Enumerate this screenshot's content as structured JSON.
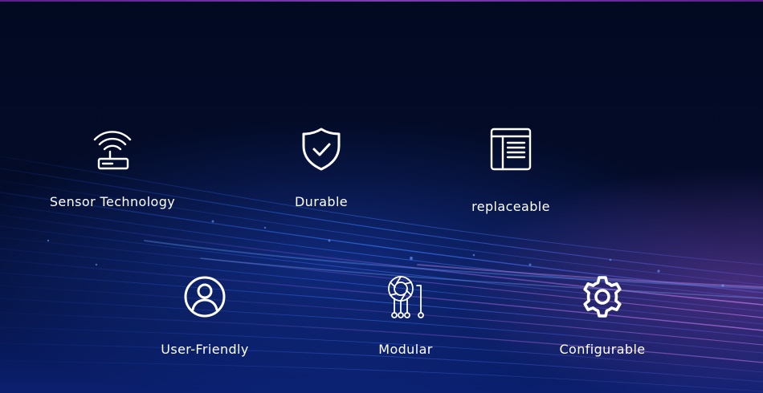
{
  "features": {
    "sensor": {
      "label": "Sensor Technology",
      "icon": "wifi-router-icon"
    },
    "durable": {
      "label": "Durable",
      "icon": "shield-check-icon"
    },
    "replaceable": {
      "label": "replaceable",
      "icon": "layout-panel-icon"
    },
    "user_friendly": {
      "label": "User-Friendly",
      "icon": "user-circle-icon"
    },
    "modular": {
      "label": "Modular",
      "icon": "circuit-module-icon"
    },
    "configurable": {
      "label": "Configurable",
      "icon": "gear-icon"
    }
  },
  "colors": {
    "background": "#020a22",
    "accent_blue": "#2f6bff",
    "accent_purple": "#9a5bd0",
    "text": "#ffffff"
  }
}
